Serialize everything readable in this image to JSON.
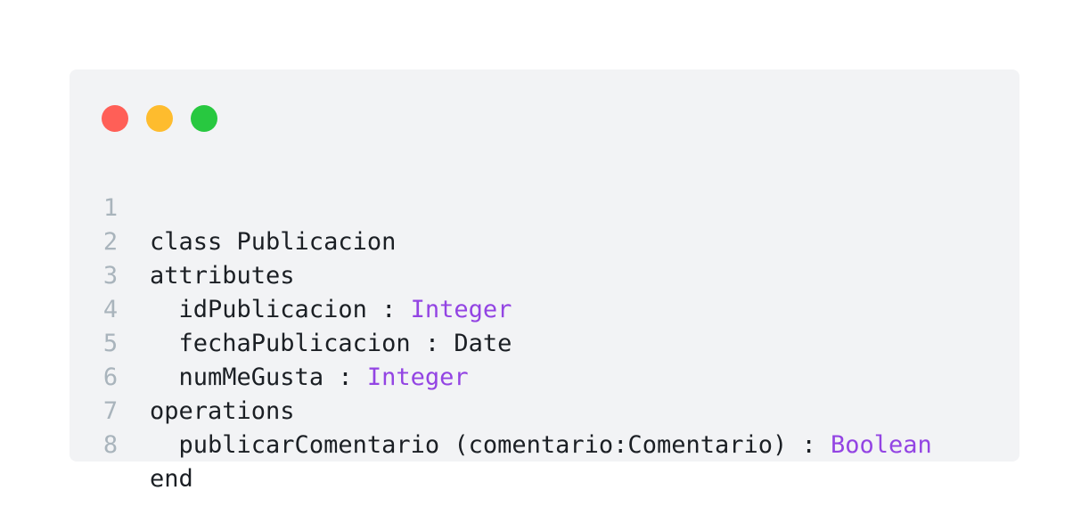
{
  "colors": {
    "background": "#ffffff",
    "window_background": "#f2f3f5",
    "close_dot": "#ff5f57",
    "minimize_dot": "#febc2e",
    "maximize_dot": "#28c840",
    "line_number": "#a9b4bc",
    "text": "#1b1f24",
    "type_keyword": "#9344e3"
  },
  "lines": [
    {
      "number": "1",
      "indent": "",
      "code": "class Publicacion",
      "type": ""
    },
    {
      "number": "2",
      "indent": "",
      "code": "attributes",
      "type": ""
    },
    {
      "number": "3",
      "indent": "  ",
      "code": "idPublicacion : ",
      "type": "Integer"
    },
    {
      "number": "4",
      "indent": "  ",
      "code": "fechaPublicacion : Date",
      "type": ""
    },
    {
      "number": "5",
      "indent": "  ",
      "code": "numMeGusta : ",
      "type": "Integer"
    },
    {
      "number": "6",
      "indent": "",
      "code": "operations",
      "type": ""
    },
    {
      "number": "7",
      "indent": "  ",
      "code": "publicarComentario (comentario:Comentario) : ",
      "type": "Boolean"
    },
    {
      "number": "8",
      "indent": "",
      "code": "end",
      "type": ""
    }
  ]
}
